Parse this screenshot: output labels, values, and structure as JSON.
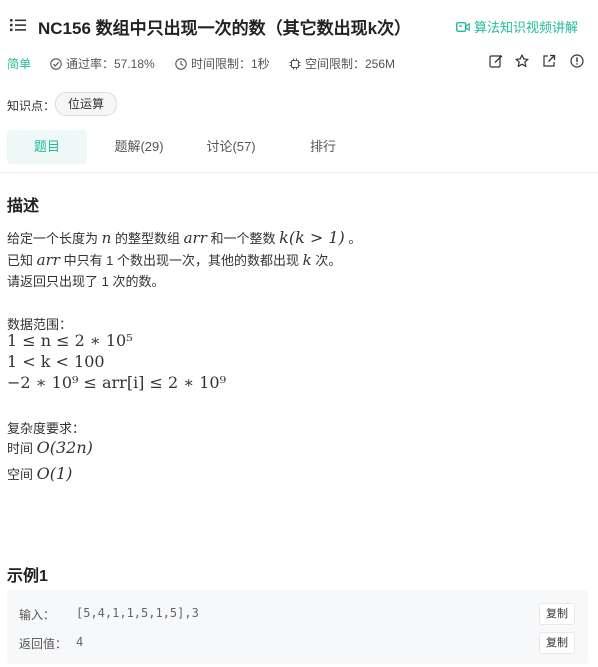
{
  "header": {
    "title": "NC156  数组中只出现一次的数（其它数出现k次）",
    "video_link": "算法知识视频讲解"
  },
  "meta": {
    "difficulty": "简单",
    "pass_rate": "通过率：57.18%",
    "time_limit": "时间限制：1秒",
    "space_limit": "空间限制：256M"
  },
  "knowledge": {
    "label": "知识点：",
    "tag": "位运算"
  },
  "tabs": [
    {
      "label": "题目"
    },
    {
      "label": "题解(29)"
    },
    {
      "label": "讨论(57)"
    },
    {
      "label": "排行"
    }
  ],
  "description": {
    "title": "描述",
    "line1_a": "给定一个长度为",
    "line1_n": "n",
    "line1_b": "的整型数组",
    "line1_arr": "arr",
    "line1_c": "和一个整数",
    "line1_k": "k(k > 1)",
    "line1_d": "。",
    "line2_a": "已知",
    "line2_arr": "arr",
    "line2_b": "中只有 1 个数出现一次，其他的数都出现",
    "line2_k": "k",
    "line2_c": "次。",
    "line3": "请返回只出现了 1 次的数。",
    "range_label": "数据范围：",
    "range1": "1 ≤ n ≤ 2 ∗ 10⁵",
    "range2": "1 < k < 100",
    "range3": "−2 ∗ 10⁹ ≤ arr[i] ≤ 2 ∗ 10⁹",
    "complexity_label": "复杂度要求：",
    "time_label": "时间",
    "time_value": "O(32n)",
    "space_label": "空间",
    "space_value": "O(1)"
  },
  "example": {
    "title": "示例1",
    "input_label": "输入：",
    "input_value": "[5,4,1,1,5,1,5],3",
    "output_label": "返回值：",
    "output_value": "4",
    "copy_label": "复制"
  },
  "colors": {
    "accent": "#25bb9b",
    "text": "#333333",
    "example_bg": "#f7f8fa"
  }
}
